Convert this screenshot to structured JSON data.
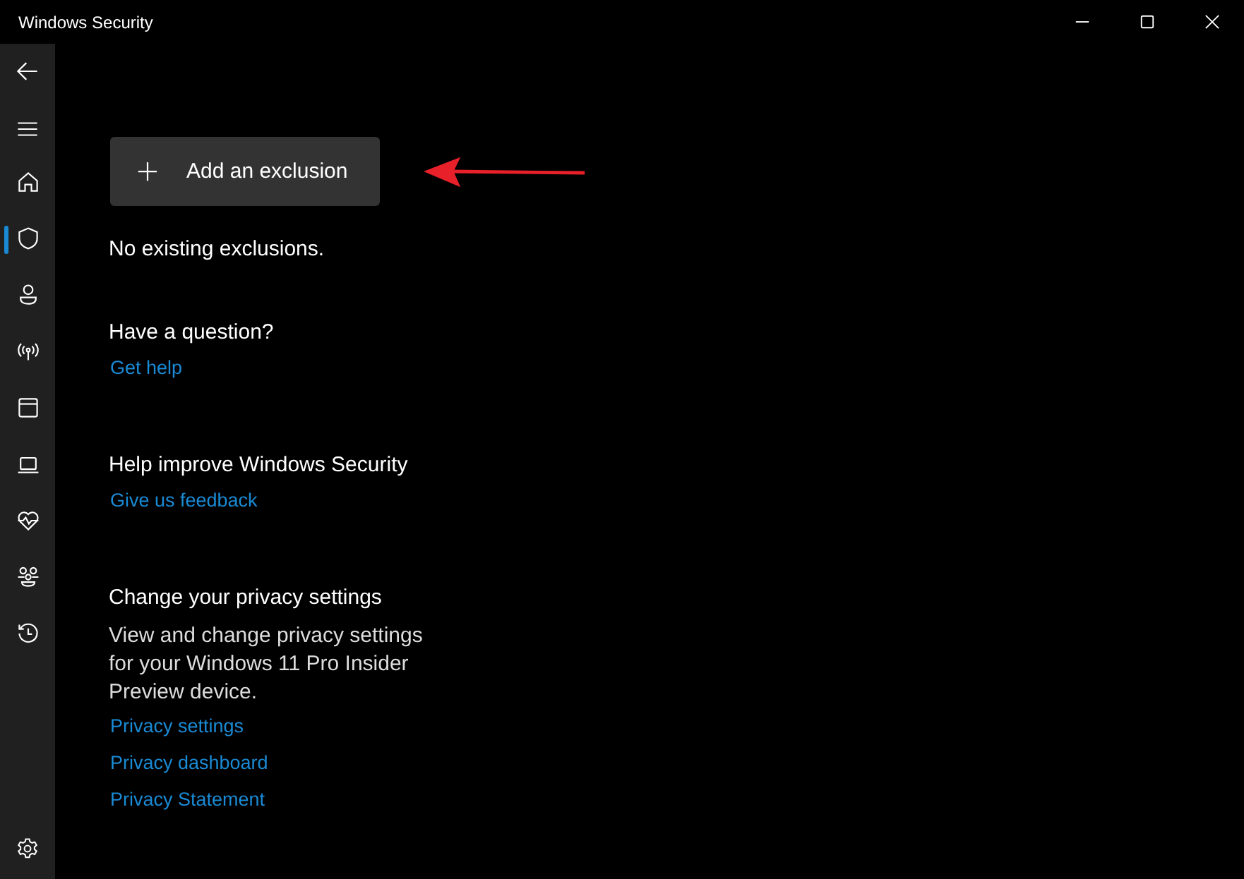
{
  "window": {
    "title": "Windows Security"
  },
  "sidebar": {
    "items": [
      {
        "kind": "home",
        "selected": false
      },
      {
        "kind": "shield",
        "selected": true
      },
      {
        "kind": "person",
        "selected": false
      },
      {
        "kind": "signal",
        "selected": false
      },
      {
        "kind": "window",
        "selected": false
      },
      {
        "kind": "laptop",
        "selected": false
      },
      {
        "kind": "heart",
        "selected": false
      },
      {
        "kind": "family",
        "selected": false
      },
      {
        "kind": "history",
        "selected": false
      }
    ]
  },
  "add_button": {
    "label": "Add an exclusion"
  },
  "status_text": "No existing exclusions.",
  "sections": [
    {
      "heading": "Have a question?",
      "links": [
        "Get help"
      ]
    },
    {
      "heading": "Help improve Windows Security",
      "links": [
        "Give us feedback"
      ]
    },
    {
      "heading": "Change your privacy settings",
      "body": "View and change privacy settings for your Windows 11 Pro Insider Preview device.",
      "links": [
        "Privacy settings",
        "Privacy dashboard",
        "Privacy Statement"
      ]
    }
  ]
}
